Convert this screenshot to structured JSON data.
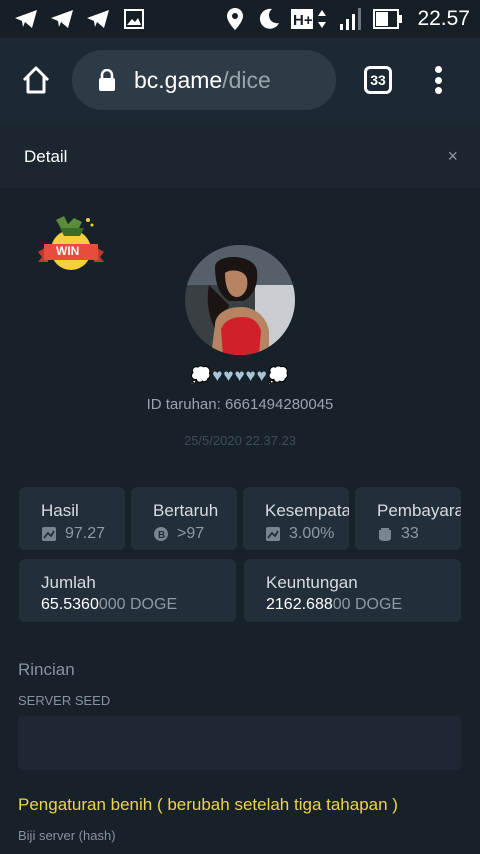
{
  "status_bar": {
    "time": "22.57",
    "network": "H+",
    "icons": [
      "telegram-icon",
      "telegram-icon",
      "telegram-icon",
      "image-icon",
      "location-icon",
      "moon-icon",
      "network-icon",
      "signal-icon",
      "battery-icon"
    ]
  },
  "browser": {
    "url_host": "bc.game",
    "url_path": "/dice",
    "tab_count": "33"
  },
  "detail": {
    "title": "Detail",
    "close": "×",
    "badge": "WIN",
    "username": "💭♥♥♥♥♥💭",
    "bet_id": "ID taruhan: 6661494280045",
    "date": "25/5/2020 22.37.23"
  },
  "stats": [
    {
      "label": "Hasil",
      "value": "97.27",
      "icon": "chart-icon"
    },
    {
      "label": "Bertaruh",
      "value": ">97",
      "icon": "coin-icon"
    },
    {
      "label": "Kesempatan",
      "value": "3.00%",
      "icon": "chart-icon"
    },
    {
      "label": "Pembayaran",
      "value": "33",
      "icon": "payout-icon"
    }
  ],
  "amounts": {
    "amount": {
      "label": "Jumlah",
      "value_main": "65.5360",
      "value_tail": "000",
      "currency": "DOGE"
    },
    "profit": {
      "label": "Keuntungan",
      "value_main": "2162.688",
      "value_tail": "00",
      "currency": "DOGE"
    }
  },
  "details_section": {
    "title": "Rincian",
    "server_seed_label": "SERVER SEED",
    "seed_note": "Pengaturan benih ( berubah setelah tiga tahapan )",
    "hash_label": "Biji server (hash)"
  },
  "colors": {
    "background": "#17212a",
    "card": "#222e3a",
    "accent_yellow": "#eed445"
  }
}
